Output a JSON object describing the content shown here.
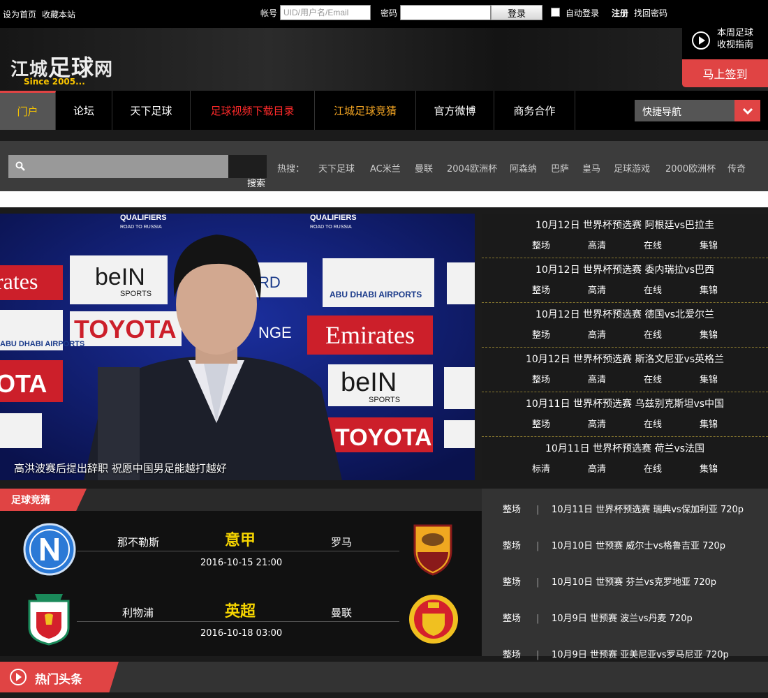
{
  "topbar": {
    "set_home": "设为首页",
    "bookmark": "收藏本站",
    "account_label": "帐号",
    "account_placeholder": "UID/用户名/Email",
    "password_label": "密码",
    "login_button": "登录",
    "auto_login": "自动登录",
    "register": "注册",
    "forgot": "找回密码"
  },
  "header": {
    "logo_part1": "江城",
    "logo_part2": "足球",
    "logo_part3": "网",
    "logo_since": "Since 2005...",
    "tv_guide": "本周足球收视指南",
    "signin": "马上签到"
  },
  "nav": {
    "items": [
      {
        "label": "门户"
      },
      {
        "label": "论坛"
      },
      {
        "label": "天下足球"
      },
      {
        "label": "足球视频下载目录"
      },
      {
        "label": "江城足球竞猜"
      },
      {
        "label": "官方微博"
      },
      {
        "label": "商务合作"
      }
    ],
    "quick_nav": "快捷导航"
  },
  "search": {
    "button": "搜索",
    "hot_label": "热搜：",
    "hot_items": [
      "天下足球",
      "AC米兰",
      "曼联",
      "2004欧洲杯",
      "阿森纳",
      "巴萨",
      "皇马",
      "足球游戏",
      "2000欧洲杯",
      "传奇"
    ]
  },
  "hero": {
    "caption": "高洪波赛后提出辞职 祝愿中国男足能越打越好",
    "bg_text": {
      "qualifiers": "QUALIFIERS",
      "road": "ROAD TO RUSSIA",
      "emirates": "Emirates",
      "toyota": "TOYOTA",
      "bein": "beIN",
      "sports": "SPORTS",
      "abu_dhabi": "ABU DHABI AIRPORTS",
      "frag_rates": "rates",
      "frag_ota": "OTA",
      "frag_ngs": "NGE",
      "frag_rd": "RD"
    }
  },
  "matches": [
    {
      "title": "10月12日 世界杯预选赛 阿根廷vs巴拉圭",
      "opts": [
        "整场",
        "高清",
        "在线",
        "集锦"
      ]
    },
    {
      "title": "10月12日 世界杯预选赛 委内瑞拉vs巴西",
      "opts": [
        "整场",
        "高清",
        "在线",
        "集锦"
      ]
    },
    {
      "title": "10月12日 世界杯预选赛 德国vs北爱尔兰",
      "opts": [
        "整场",
        "高清",
        "在线",
        "集锦"
      ]
    },
    {
      "title": "10月12日 世界杯预选赛 斯洛文尼亚vs英格兰",
      "opts": [
        "整场",
        "高清",
        "在线",
        "集锦"
      ]
    },
    {
      "title": "10月11日 世界杯预选赛 乌兹别克斯坦vs中国",
      "opts": [
        "整场",
        "高清",
        "在线",
        "集锦"
      ]
    },
    {
      "title": "10月11日 世界杯预选赛 荷兰vs法国",
      "opts": [
        "标清",
        "高清",
        "在线",
        "集锦"
      ]
    }
  ],
  "guess": {
    "tab": "足球竞猜",
    "games": [
      {
        "home": "那不勒斯",
        "league": "意甲",
        "away": "罗马",
        "time": "2016-10-15 21:00"
      },
      {
        "home": "利物浦",
        "league": "英超",
        "away": "曼联",
        "time": "2016-10-18 03:00"
      }
    ]
  },
  "downloads": [
    {
      "q": "整场",
      "sep": "|",
      "title": "10月11日 世界杯预选赛 瑞典vs保加利亚 720p"
    },
    {
      "q": "整场",
      "sep": "|",
      "title": "10月10日 世预赛 威尔士vs格鲁吉亚 720p"
    },
    {
      "q": "整场",
      "sep": "|",
      "title": "10月10日 世预赛 芬兰vs克罗地亚 720p"
    },
    {
      "q": "整场",
      "sep": "|",
      "title": "10月9日 世预赛 波兰vs丹麦 720p"
    },
    {
      "q": "整场",
      "sep": "|",
      "title": "10月9日 世预赛 亚美尼亚vs罗马尼亚 720p"
    }
  ],
  "hotnews": {
    "tab": "热门头条"
  },
  "colors": {
    "accent": "#e04444",
    "gold": "#f5c200",
    "nav_red": "#ff2a2a",
    "nav_orange": "#f5a623"
  }
}
